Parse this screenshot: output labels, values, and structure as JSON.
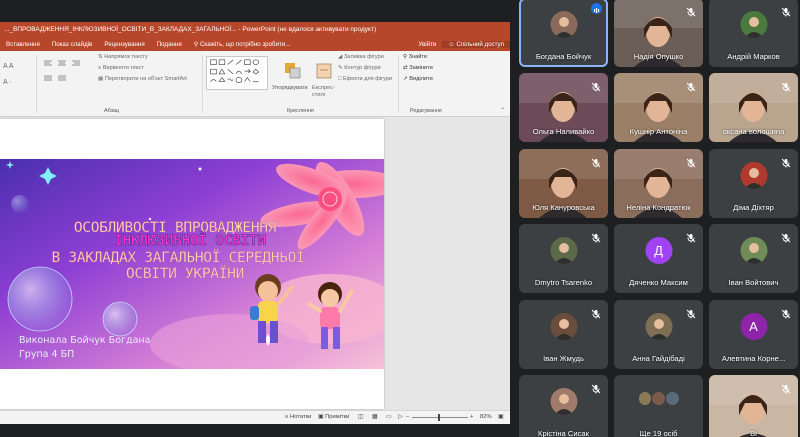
{
  "powerpoint": {
    "window_title": "..._ВПРОВАДЖЕННЯ_ІНКЛЮЗИВНОЇ_ОСВІТИ_В_ЗАКЛАДАХ_ЗАГАЛЬНОЇ... - PowerPoint (не вдалося активувати продукт)",
    "tabs": [
      "Вставлення",
      "Показ слайдів",
      "Рецензування",
      "Подання"
    ],
    "tell_me": "Скажіть, що потрібно зробити...",
    "account": "Увійти",
    "share": "Спільний доступ",
    "ribbon": {
      "paragraph": {
        "text_direction": "Напрямок тексту",
        "align_text": "Вирівняти текст",
        "convert_smartart": "Перетворити на об'єкт SmartArt",
        "label": "Абзац"
      },
      "drawing": {
        "arrange": "Упорядкувати",
        "quick_styles": "Експрес-стилі",
        "shape_fill": "Заливка фігури",
        "shape_outline": "Контур фігури",
        "shape_effects": "Ефекти для фігури",
        "label": "Креслення"
      },
      "editing": {
        "find": "Знайти",
        "replace": "Замінити",
        "select": "Виділити",
        "label": "Редагування"
      }
    },
    "slide": {
      "line1": "ОСОБЛИВОСТІ ВПРОВАДЖЕННЯ",
      "line2": "ІНКЛЮЗИВНОЇ ОСВІТИ",
      "line3": "В ЗАКЛАДАХ ЗАГАЛЬНОЇ СЕРЕДНЬОЇ",
      "line4": "ОСВІТИ УКРАЇНИ",
      "author": "Виконала Бойчук Богдана",
      "group": "Група 4 БП"
    },
    "status": {
      "notes": "Нотатки",
      "comments": "Примітки",
      "zoom": "82%"
    }
  },
  "participants": [
    {
      "name": "Богдана Бойчук",
      "speaking": true,
      "kind": "avatar-photo",
      "color": "#8a6a5a"
    },
    {
      "name": "Надія Опушко",
      "speaking": false,
      "kind": "video",
      "color": "#6b5e57"
    },
    {
      "name": "Андрій Марков",
      "speaking": false,
      "kind": "avatar-photo",
      "color": "#4a7a3e"
    },
    {
      "name": "Ольга Наливайко",
      "speaking": false,
      "kind": "video",
      "color": "#6d4a58"
    },
    {
      "name": "Кушнір Антоніна",
      "speaking": false,
      "kind": "video",
      "color": "#9b8067"
    },
    {
      "name": "оксана волошина",
      "speaking": false,
      "kind": "video",
      "color": "#b9a48e"
    },
    {
      "name": "Юля Канурoвська",
      "speaking": false,
      "kind": "video",
      "color": "#7e5a44"
    },
    {
      "name": "Неліна Кондратюк",
      "speaking": false,
      "kind": "video",
      "color": "#8b6d5c"
    },
    {
      "name": "Діма Діхтяр",
      "speaking": false,
      "kind": "avatar-photo",
      "color": "#b03a2e"
    },
    {
      "name": "Dmytro Tsarenko",
      "speaking": false,
      "kind": "avatar-photo",
      "color": "#5b6b49"
    },
    {
      "name": "Дяченко Максим",
      "speaking": false,
      "kind": "letter",
      "letter": "Д",
      "color": "#a142f4"
    },
    {
      "name": "Іван Войтович",
      "speaking": false,
      "kind": "avatar-photo",
      "color": "#6f8b57"
    },
    {
      "name": "Іван Жмудь",
      "speaking": false,
      "kind": "avatar-photo",
      "color": "#6a4c3c"
    },
    {
      "name": "Анна Гайдібаді",
      "speaking": false,
      "kind": "avatar-photo",
      "color": "#7e6e54"
    },
    {
      "name": "Алевтина Корне...",
      "speaking": false,
      "kind": "letter",
      "letter": "А",
      "color": "#8e24aa"
    },
    {
      "name": "Крістіна Сисак",
      "speaking": false,
      "kind": "avatar-photo",
      "color": "#a07a6a"
    },
    {
      "name": "Ще 19 осіб",
      "speaking": false,
      "kind": "more",
      "color": "#5f6368"
    },
    {
      "name": "Ві",
      "speaking": false,
      "kind": "video",
      "color": "#c9b6a3"
    }
  ]
}
